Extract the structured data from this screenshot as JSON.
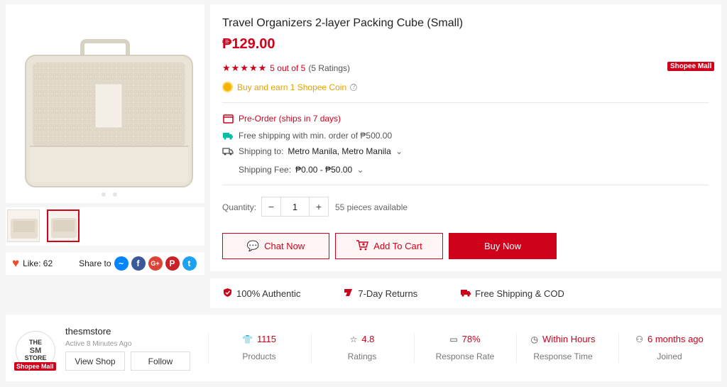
{
  "product": {
    "title": "Travel Organizers 2-layer Packing Cube (Small)",
    "price": "₱129.00",
    "rating_text": "5 out of 5",
    "ratings_count": "(5 Ratings)",
    "mall_badge": "Shopee Mall",
    "coin_text": "Buy and earn 1 Shopee Coin",
    "preorder": "Pre-Order (ships in 7 days)",
    "free_shipping": "Free shipping with min. order of ₱500.00",
    "shipping_to_label": "Shipping to:",
    "shipping_to_value": "Metro Manila, Metro Manila",
    "shipping_fee_label": "Shipping Fee:",
    "shipping_fee_value": "₱0.00 - ₱50.00",
    "quantity_label": "Quantity:",
    "quantity_value": "1",
    "qty_minus": "−",
    "qty_plus": "+",
    "stock_text": "55 pieces available",
    "chat_label": "Chat Now",
    "cart_label": "Add To Cart",
    "buy_label": "Buy Now"
  },
  "gallery": {
    "like_text": "Like: 62",
    "share_label": "Share to",
    "share_icons": [
      "messenger-icon",
      "facebook-icon",
      "google-plus-icon",
      "pinterest-icon",
      "twitter-icon"
    ]
  },
  "guarantees": {
    "authentic": "100% Authentic",
    "returns": "7-Day Returns",
    "shipping": "Free Shipping & COD"
  },
  "shop": {
    "logo_line1": "THE",
    "logo_line2": "SM",
    "logo_line3": "STORE",
    "mall_badge": "Shopee Mall",
    "name": "thesmstore",
    "active": "Active 8 Minutes Ago",
    "view_shop": "View Shop",
    "follow": "Follow",
    "stats": {
      "products_value": "1115",
      "products_label": "Products",
      "ratings_value": "4.8",
      "ratings_label": "Ratings",
      "response_rate_value": "78%",
      "response_rate_label": "Response Rate",
      "response_time_value": "Within Hours",
      "response_time_label": "Response Time",
      "joined_value": "6 months ago",
      "joined_label": "Joined"
    }
  },
  "colors": {
    "accent": "#d0011b",
    "coin": "#e6a100",
    "shipping_green": "#00bfa5"
  }
}
